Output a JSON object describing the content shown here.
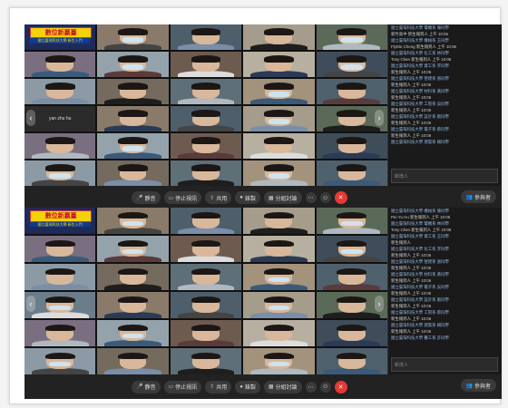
{
  "window_top": {
    "slide": {
      "banner": "數位新贏臺",
      "strip": "國立臺灣科技大學 新生入門"
    },
    "name_tile": "yan zhu hu",
    "toolbar": {
      "mute": "靜音",
      "video": "停止視訊",
      "share": "共用",
      "record": "錄製",
      "breakout": "分組討論",
      "hangup": "✕",
      "participants": "參與者"
    },
    "chat": {
      "placeholder": "新增人",
      "messages": [
        "國立臺灣科技大學 電機系 陳同學",
        "新竹高中 新生報到人 上午 10:06",
        "國立臺灣科技大學 機械系 王同學",
        "FlyDie Cheng 新生報到人 上午 10:06",
        "國立臺灣科技大學 化工系 林同學",
        "Tony Chen 新生報到人 上午 10:06",
        "國立臺灣科技大學 資工系 李同學",
        "新生報到人 上午 10:06",
        "國立臺灣科技大學 營建系 張同學",
        "新生報到人 上午 10:06",
        "國立臺灣科技大學 材料系 黃同學",
        "新生報到人 上午 10:06",
        "國立臺灣科技大學 工管系 吳同學",
        "新生報到人 上午 10:06",
        "國立臺灣科技大學 設計系 劉同學",
        "新生報到人 上午 10:06",
        "國立臺灣科技大學 電子系 蔡同學",
        "新生報到人 上午 10:06",
        "國立臺灣科技大學 建築系 楊同學"
      ]
    }
  },
  "window_bottom": {
    "slide": {
      "banner": "數位新贏臺",
      "strip": "國立臺灣科技大學 新生入門"
    },
    "toolbar": {
      "mute": "靜音",
      "video": "停止視訊",
      "share": "共用",
      "record": "錄製",
      "breakout": "分組討論",
      "hangup": "✕",
      "participants": "參與者"
    },
    "chat": {
      "placeholder": "新增人",
      "messages": [
        "國立臺灣科技大學 機械系 陳同學",
        "Pei-Yu Hu 新生報到人 上午 10:06",
        "國立臺灣科技大學 電機系 林同學",
        "Tony Chen 新生報到人 上午 10:06",
        "國立臺灣科技大學 資工系 王同學",
        "新生報到人",
        "國立臺灣科技大學 化工系 李同學",
        "新生報到人 上午 10:06",
        "國立臺灣科技大學 營建系 張同學",
        "新生報到人 上午 10:06",
        "國立臺灣科技大學 材料系 黃同學",
        "新生報到人 上午 10:06",
        "國立臺灣科技大學 電子系 吳同學",
        "新生報到人 上午 10:06",
        "國立臺灣科技大學 設計系 劉同學",
        "新生報到人 上午 10:06",
        "國立臺灣科技大學 工管系 蔡同學",
        "新生報到人 上午 10:06",
        "國立臺灣科技大學 建築系 楊同學",
        "新生報到人 上午 10:06",
        "國立臺灣科技大學 醫工系 許同學"
      ]
    }
  },
  "colors": {
    "hangup": "#e53935",
    "toolbar": "#222222",
    "chat_bg": "#1a1a1a",
    "sender": "#8fb3e0",
    "banner": "#f5d10a"
  }
}
